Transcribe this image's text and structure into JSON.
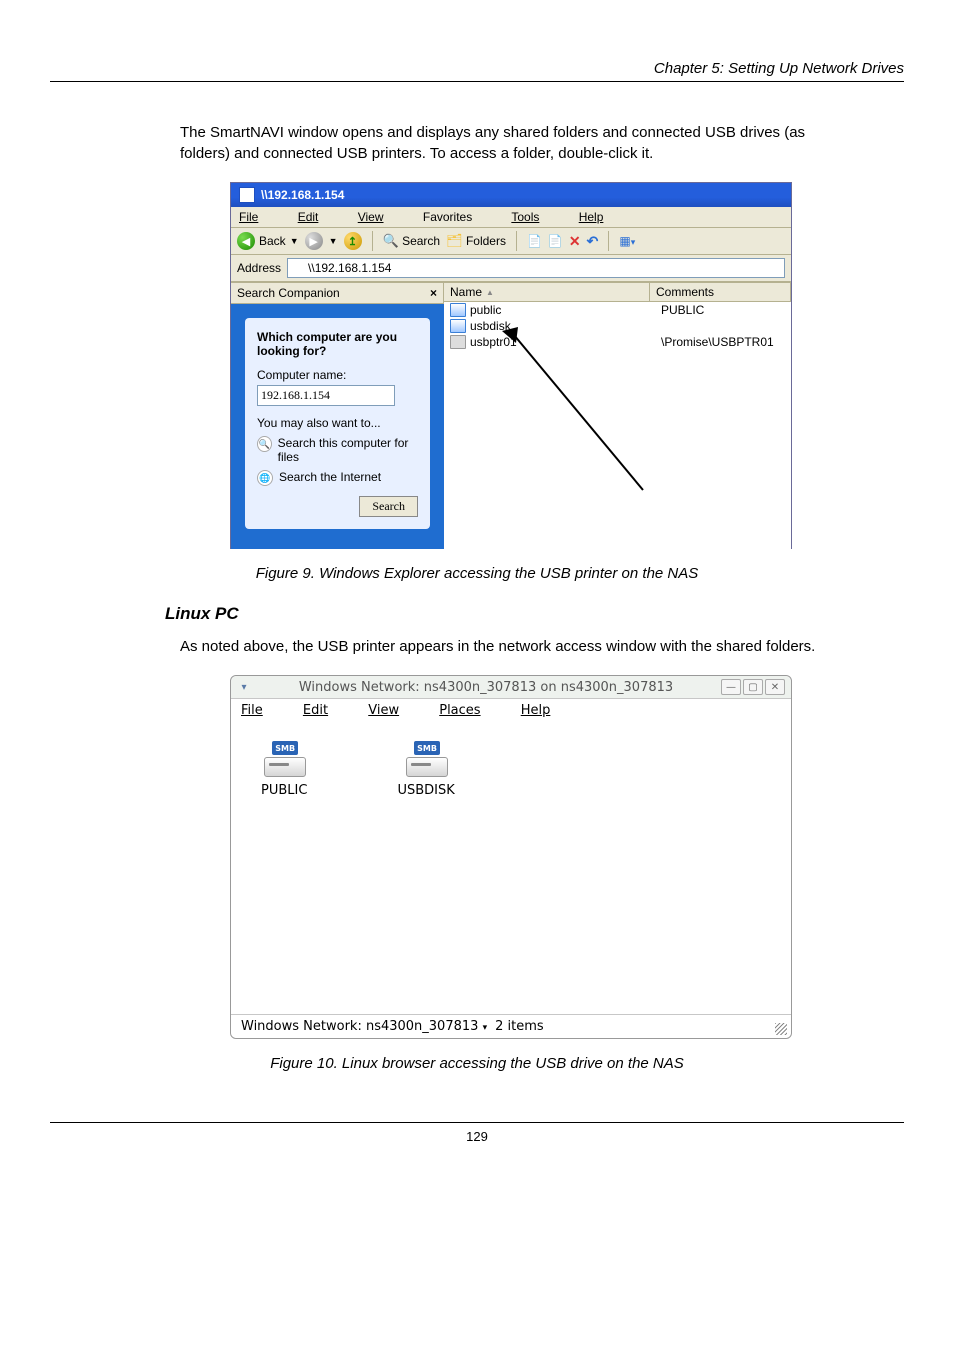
{
  "doc_header_right": "Chapter 5: Setting Up Network Drives",
  "para1": "The SmartNAVI window opens and displays any shared folders and connected USB drives (as folders) and connected USB printers. To access a folder, double-click it.",
  "fig1_caption": "Figure 9. Windows Explorer accessing the USB printer on the NAS",
  "h3": "Linux PC",
  "para2": "As noted above, the USB printer appears in the network access window with the shared folders.",
  "fig2_caption": "Figure 10. Linux browser accessing the USB drive on the NAS",
  "footer_page": "129",
  "xp": {
    "title": "\\\\192.168.1.154",
    "menu": {
      "file": "File",
      "edit": "Edit",
      "view": "View",
      "favorites": "Favorites",
      "tools": "Tools",
      "help": "Help"
    },
    "toolbar": {
      "back": "Back",
      "search": "Search",
      "folders": "Folders"
    },
    "address_label": "Address",
    "address_value": "\\\\192.168.1.154",
    "side": {
      "header": "Search Companion",
      "question": "Which computer are you looking for?",
      "name_label": "Computer name:",
      "name_value": "192.168.1.154",
      "also": "You may also want to...",
      "link1": "Search this computer for files",
      "link2": "Search the Internet",
      "search_btn": "Search"
    },
    "list": {
      "col_name": "Name",
      "col_comments": "Comments",
      "rows": [
        {
          "name": "public",
          "comment": "PUBLIC",
          "type": "share"
        },
        {
          "name": "usbdisk",
          "comment": "",
          "type": "share"
        },
        {
          "name": "usbptr01",
          "comment": "\\Promise\\USBPTR01",
          "type": "printer"
        }
      ]
    }
  },
  "naut": {
    "title": "Windows Network: ns4300n_307813 on ns4300n_307813",
    "menu": {
      "file": "File",
      "edit": "Edit",
      "view": "View",
      "places": "Places",
      "help": "Help"
    },
    "icons": [
      {
        "label": "PUBLIC"
      },
      {
        "label": "USBDISK"
      }
    ],
    "status_path": "Windows Network: ns4300n_307813",
    "status_items": "2 items"
  }
}
